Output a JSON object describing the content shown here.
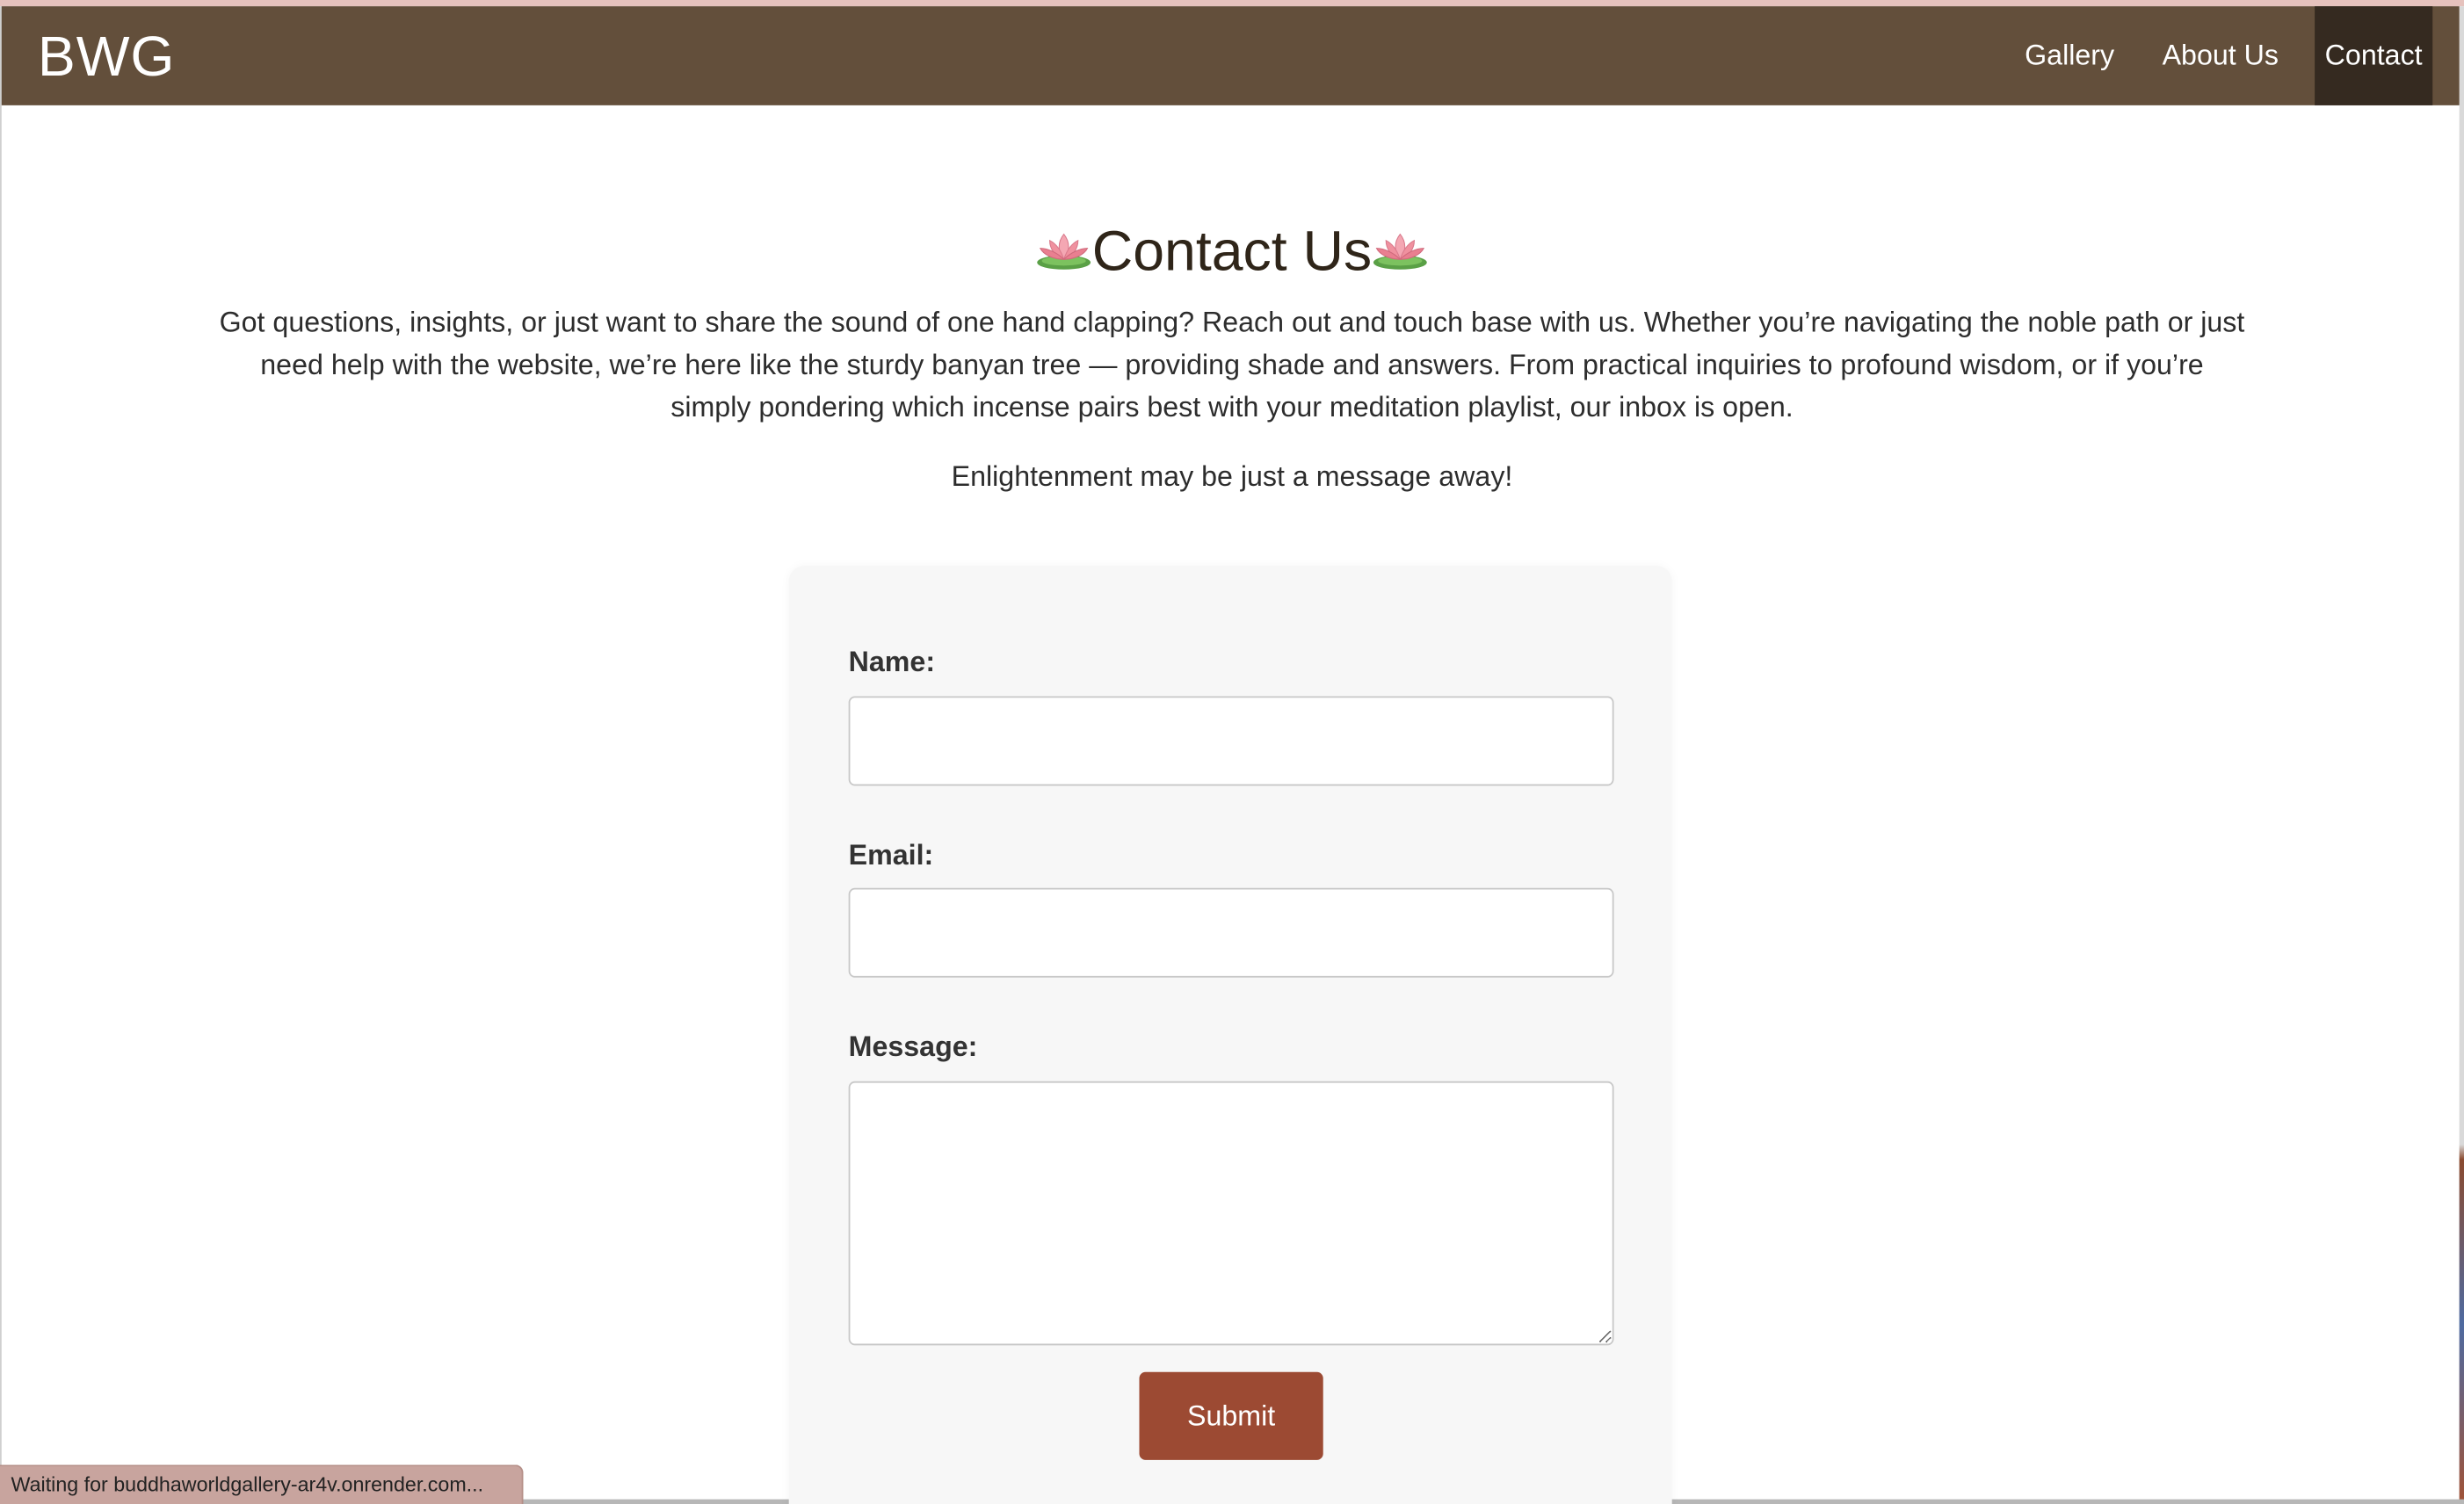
{
  "navbar": {
    "brand": "BWG",
    "links": [
      "Gallery",
      "About Us",
      "Contact"
    ],
    "active": "Contact",
    "bg_color": "#634f3b",
    "active_color": "#352a20"
  },
  "main": {
    "title": "Contact Us",
    "title_icon": "lotus-icon",
    "intro": "Got questions, insights, or just want to share the sound of one hand clapping? Reach out and touch base with us. Whether you’re navigating the noble path or just need help with the website, we’re here like the sturdy banyan tree — providing shade and answers. From practical inquiries to profound wisdom, or if you’re simply pondering which incense pairs best with your meditation playlist, our inbox is open.",
    "tagline": "Enlightenment may be just a message away!"
  },
  "form": {
    "name_label": "Name:",
    "name_value": "",
    "email_label": "Email:",
    "email_value": "",
    "message_label": "Message:",
    "message_value": "",
    "submit_label": "Submit",
    "submit_color": "#9c4a33"
  },
  "status_bar": {
    "text": "Waiting for buddhaworldgallery-ar4v.onrender.com..."
  }
}
